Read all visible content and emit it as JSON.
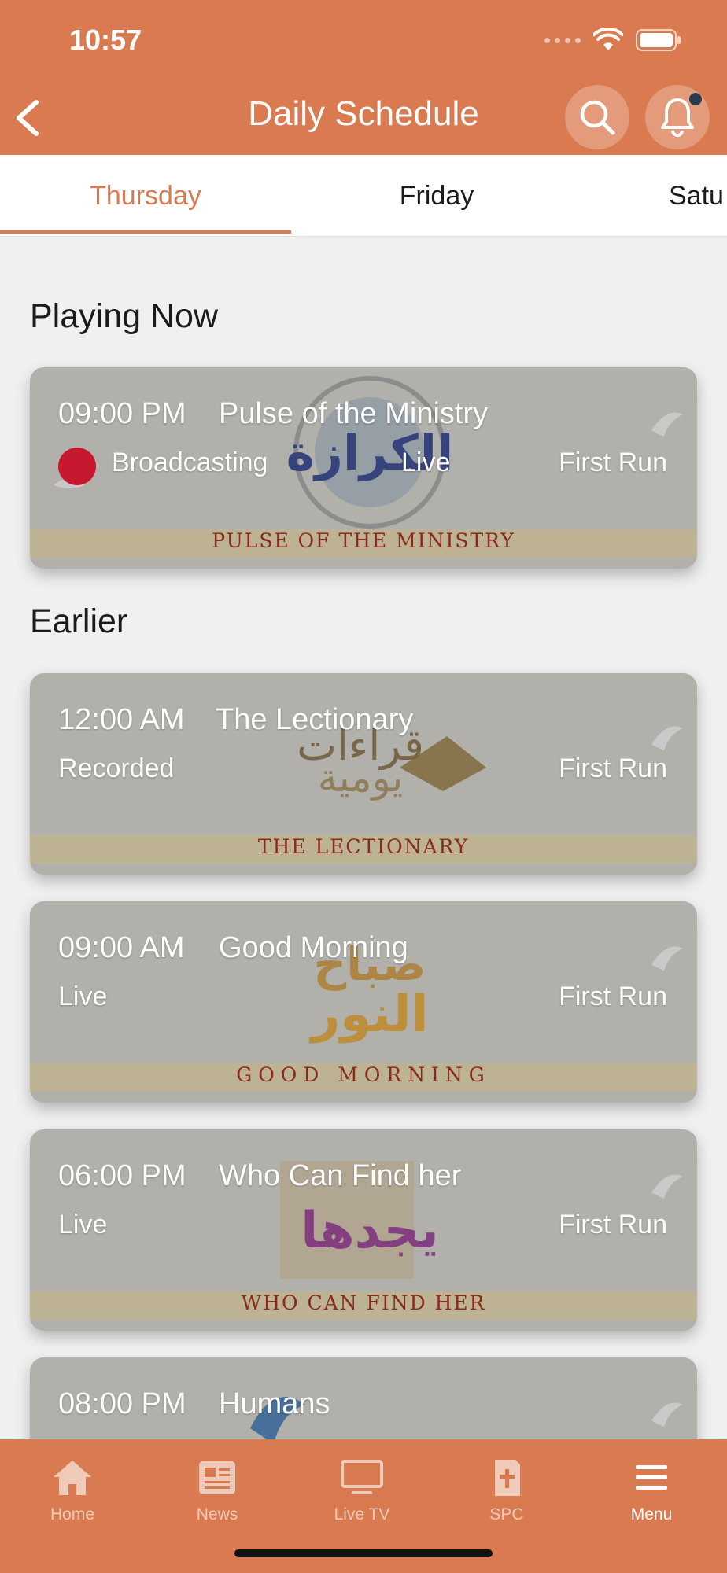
{
  "status_bar": {
    "time": "10:57"
  },
  "header": {
    "title": "Daily Schedule"
  },
  "tabs": [
    {
      "label": "Thursday",
      "active": true
    },
    {
      "label": "Friday",
      "active": false
    },
    {
      "label": "Satu",
      "active": false
    }
  ],
  "sections": {
    "playing_now": "Playing Now",
    "earlier": "Earlier"
  },
  "now_playing": {
    "time": "09:00 PM",
    "name": "Pulse of the Ministry",
    "status": "Broadcasting",
    "mode": "Live",
    "run": "First Run",
    "banner": "PULSE OF THE MINISTRY"
  },
  "earlier_items": [
    {
      "time": "12:00 AM",
      "name": "The Lectionary",
      "status": "Recorded",
      "run": "First Run",
      "banner": "THE LECTIONARY"
    },
    {
      "time": "09:00 AM",
      "name": "Good Morning",
      "status": "Live",
      "run": "First Run",
      "banner": "GOOD MORNING"
    },
    {
      "time": "06:00 PM",
      "name": "Who Can Find her",
      "status": "Live",
      "run": "First Run",
      "banner": "WHO CAN FIND HER"
    },
    {
      "time": "08:00 PM",
      "name": "Humans",
      "status": "",
      "run": "",
      "banner": ""
    }
  ],
  "bottom_nav": [
    {
      "label": "Home",
      "icon": "home-icon",
      "active": false
    },
    {
      "label": "News",
      "icon": "news-icon",
      "active": false
    },
    {
      "label": "Live TV",
      "icon": "tv-icon",
      "active": false
    },
    {
      "label": "SPC",
      "icon": "bible-icon",
      "active": false
    },
    {
      "label": "Menu",
      "icon": "menu-icon",
      "active": true
    }
  ],
  "colors": {
    "accent": "#da7a50",
    "live_dot": "#c8182f",
    "background": "#f0f0f0"
  }
}
